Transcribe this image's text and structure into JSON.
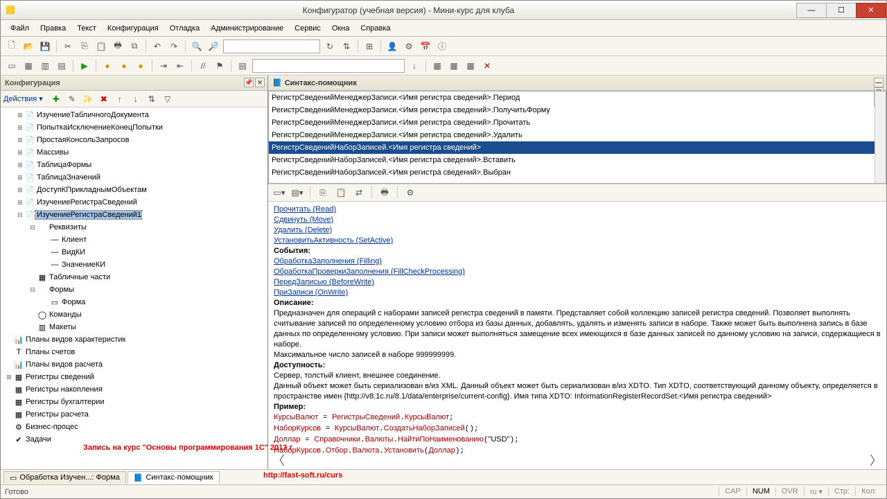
{
  "title": "Конфигуратор (учебная версия) - Мини-курс для клуба",
  "menu": [
    "Файл",
    "Правка",
    "Текст",
    "Конфигурация",
    "Отладка",
    "Администрирование",
    "Сервис",
    "Окна",
    "Справка"
  ],
  "leftPane": {
    "title": "Конфигурация",
    "actionsLabel": "Действия ▾",
    "tree": [
      {
        "ind": 1,
        "exp": "⊞",
        "ic": "📄",
        "lbl": "ИзучениеТабличногоДокумента"
      },
      {
        "ind": 1,
        "exp": "⊞",
        "ic": "📄",
        "lbl": "ПопыткаИсключениеКонецПопытки"
      },
      {
        "ind": 1,
        "exp": "⊞",
        "ic": "📄",
        "lbl": "ПростаяКонсольЗапросов"
      },
      {
        "ind": 1,
        "exp": "⊞",
        "ic": "📄",
        "lbl": "Массивы"
      },
      {
        "ind": 1,
        "exp": "⊞",
        "ic": "📄",
        "lbl": "ТаблицаФормы"
      },
      {
        "ind": 1,
        "exp": "⊞",
        "ic": "📄",
        "lbl": "ТаблицаЗначений"
      },
      {
        "ind": 1,
        "exp": "⊞",
        "ic": "📄",
        "lbl": "ДоступКПрикладнымОбъектам"
      },
      {
        "ind": 1,
        "exp": "⊞",
        "ic": "📄",
        "lbl": "ИзучениеРегистраСведений"
      },
      {
        "ind": 1,
        "exp": "⊟",
        "ic": "📄",
        "lbl": "ИзучениеРегистраСведений1",
        "sel": true
      },
      {
        "ind": 2,
        "exp": "⊟",
        "ic": "",
        "lbl": "Реквизиты"
      },
      {
        "ind": 3,
        "exp": "",
        "ic": "—",
        "lbl": "Клиент"
      },
      {
        "ind": 3,
        "exp": "",
        "ic": "—",
        "lbl": "ВидКИ"
      },
      {
        "ind": 3,
        "exp": "",
        "ic": "—",
        "lbl": "ЗначениеКИ"
      },
      {
        "ind": 2,
        "exp": "",
        "ic": "▦",
        "lbl": "Табличные части"
      },
      {
        "ind": 2,
        "exp": "⊟",
        "ic": "",
        "lbl": "Формы"
      },
      {
        "ind": 3,
        "exp": "",
        "ic": "▭",
        "lbl": "Форма"
      },
      {
        "ind": 2,
        "exp": "",
        "ic": "◯",
        "lbl": "Команды"
      },
      {
        "ind": 2,
        "exp": "",
        "ic": "▥",
        "lbl": "Макеты"
      },
      {
        "ind": 0,
        "exp": "",
        "ic": "📊",
        "lbl": "Планы видов характеристик"
      },
      {
        "ind": 0,
        "exp": "",
        "ic": "Т",
        "lbl": "Планы счетов"
      },
      {
        "ind": 0,
        "exp": "",
        "ic": "📊",
        "lbl": "Планы видов расчета"
      },
      {
        "ind": 0,
        "exp": "⊞",
        "ic": "▦",
        "lbl": "Регистры сведений"
      },
      {
        "ind": 0,
        "exp": "",
        "ic": "▦",
        "lbl": "Регистры накопления"
      },
      {
        "ind": 0,
        "exp": "",
        "ic": "▦",
        "lbl": "Регистры бухгалтерии"
      },
      {
        "ind": 0,
        "exp": "",
        "ic": "▦",
        "lbl": "Регистры расчета"
      },
      {
        "ind": 0,
        "exp": "",
        "ic": "⚙",
        "lbl": "Бизнес-процес"
      },
      {
        "ind": 0,
        "exp": "",
        "ic": "✔",
        "lbl": "Задачи"
      }
    ]
  },
  "syntaxPane": {
    "title": "Синтакс-помощник",
    "list": [
      "РегистрСведенийМенеджерЗаписи.<Имя регистра сведений>.Период",
      "РегистрСведенийМенеджерЗаписи.<Имя регистра сведений>.ПолучитьФорму",
      "РегистрСведенийМенеджерЗаписи.<Имя регистра сведений>.Прочитать",
      "РегистрСведенийМенеджерЗаписи.<Имя регистра сведений>.Удалить",
      "РегистрСведенийНаборЗаписей.<Имя регистра сведений>",
      "РегистрСведенийНаборЗаписей.<Имя регистра сведений>.Вставить",
      "РегистрСведенийНаборЗаписей.<Имя регистра сведений>.Выбран"
    ],
    "selectedIndex": 4,
    "help": {
      "methods": [
        "Прочитать (Read)",
        "Сдвинуть (Move)",
        "Удалить (Delete)",
        "УстановитьАктивность (SetActive)"
      ],
      "eventsLabel": "События:",
      "events": [
        "ОбработкаЗаполнения (Filling)",
        "ОбработкаПроверкиЗаполнения (FillCheckProcessing)",
        "ПередЗаписью (BeforeWrite)",
        "ПриЗаписи (OnWrite)"
      ],
      "descLabel": "Описание:",
      "desc": "Предназначен для операций с наборами записей регистра сведений в памяти. Представляет собой коллекцию записей регистра сведений. Позволяет выполнять считывание записей по определенному условию отбора из базы данных, добавлять, удалять и изменять записи в наборе. Также может быть выполнена запись в базе данных по определенному условию. При записи может выполняться замещение всех имеющихся в базе данных записей по данному условию на записи, содержащиеся в наборе.",
      "desc2": "Максимальное число записей в наборе 999999999.",
      "availLabel": "Доступность:",
      "avail1": "Сервер, толстый клиент, внешнее соединение.",
      "avail2": "Данный объект может быть сериализован в/из XML. Данный объект может быть сериализован в/из XDTO. Тип XDTO, соответствующий данному объекту, определяется в пространстве имен {http://v8.1c.ru/8.1/data/enterprise/current-config}. Имя типа XDTO: InformationRegisterRecordSet.<Имя регистра сведений>",
      "exampleLabel": "Пример:",
      "code": "КурсыВалют = РегистрыСведений.КурсыВалют;\nНаборКурсов = КурсыВалют.СоздатьНаборЗаписей();\nДоллар = Справочники.Валюты.НайтиПоНаименованию(\"USD\");\nНаборКурсов.Отбор.Валюта.Установить(Доллар);"
    }
  },
  "tabs": [
    {
      "label": "Обработка Изучен...: Форма",
      "ic": "▭"
    },
    {
      "label": "Синтакс-помощник",
      "ic": "📘",
      "active": true
    }
  ],
  "status": {
    "text": "Готово",
    "cells": [
      "CAP",
      "NUM",
      "OVR",
      "ru ▾",
      "Стр:",
      "Кол:"
    ]
  },
  "overlay": {
    "line1": "Запись на курс \"Основы программирования 1С\" 2013 г",
    "line2": "http://fast-soft.ru/curs"
  }
}
